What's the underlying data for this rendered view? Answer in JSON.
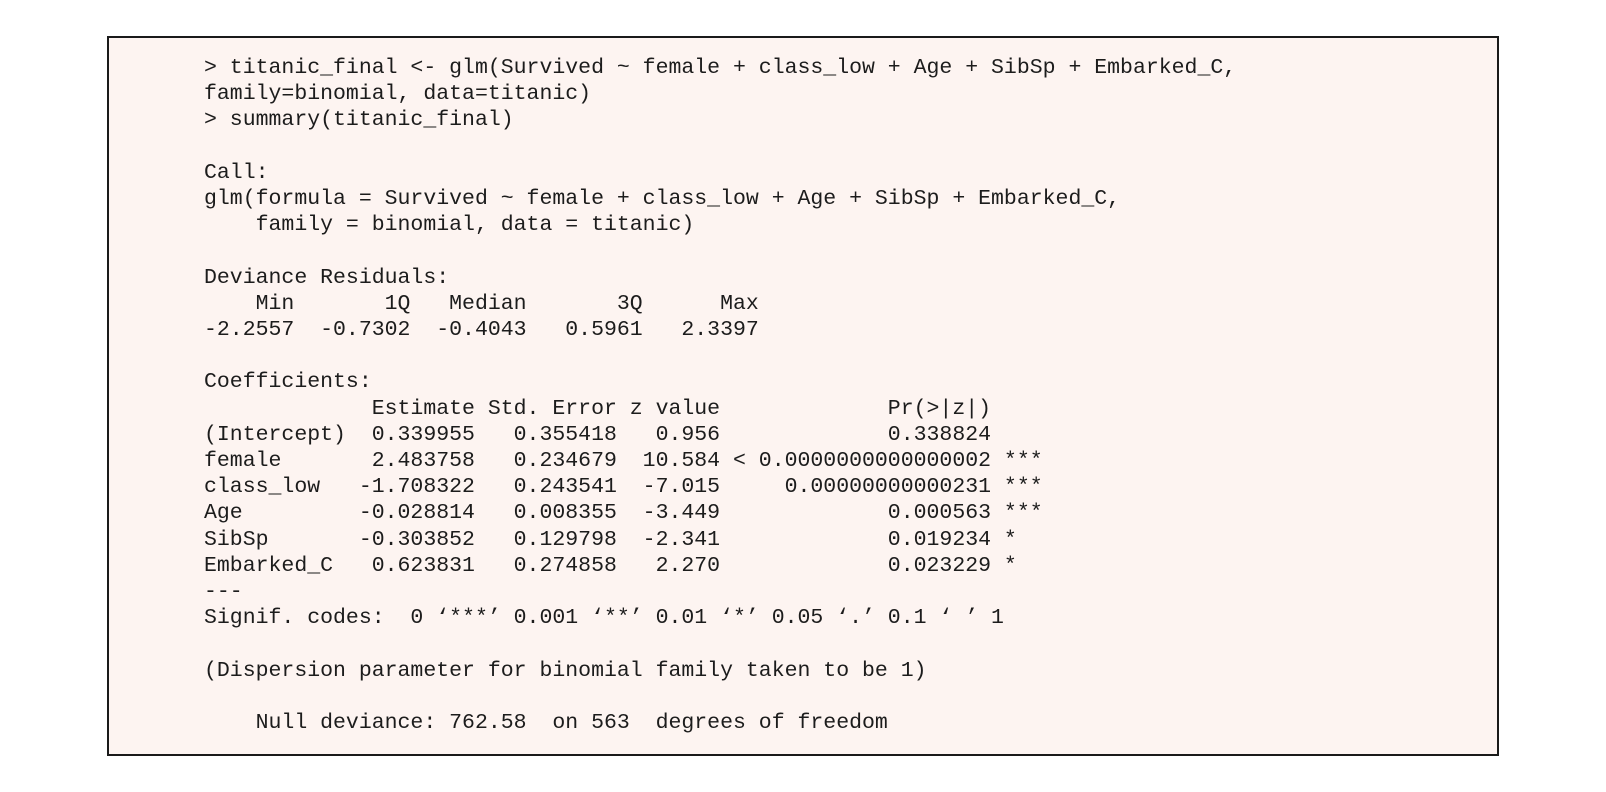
{
  "console": {
    "lines": [
      "> titanic_final <- glm(Survived ~ female + class_low + Age + SibSp + Embarked_C,",
      "family=binomial, data=titanic)",
      "> summary(titanic_final)",
      "",
      "Call:",
      "glm(formula = Survived ~ female + class_low + Age + SibSp + Embarked_C,",
      "    family = binomial, data = titanic)",
      "",
      "Deviance Residuals:",
      "    Min       1Q   Median       3Q      Max",
      "-2.2557  -0.7302  -0.4043   0.5961   2.3397",
      "",
      "Coefficients:",
      "             Estimate Std. Error z value             Pr(>|z|)",
      "(Intercept)  0.339955   0.355418   0.956             0.338824",
      "female       2.483758   0.234679  10.584 < 0.0000000000000002 ***",
      "class_low   -1.708322   0.243541  -7.015     0.00000000000231 ***",
      "Age         -0.028814   0.008355  -3.449             0.000563 ***",
      "SibSp       -0.303852   0.129798  -2.341             0.019234 *",
      "Embarked_C   0.623831   0.274858   2.270             0.023229 *",
      "---",
      "Signif. codes:  0 ‘***’ 0.001 ‘**’ 0.01 ‘*’ 0.05 ‘.’ 0.1 ‘ ’ 1",
      "",
      "(Dispersion parameter for binomial family taken to be 1)",
      "",
      "    Null deviance: 762.58  on 563  degrees of freedom"
    ]
  }
}
